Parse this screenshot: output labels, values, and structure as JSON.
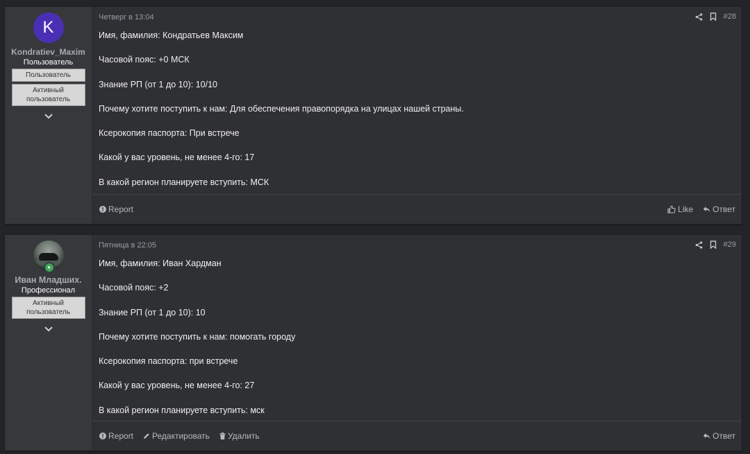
{
  "posts": [
    {
      "user": {
        "avatar_letter": "K",
        "avatar_color": "#4a2fb5",
        "name": "Kondratiev_Maxim",
        "title": "Пользователь",
        "badges": [
          "Пользователь",
          "Активный пользователь"
        ]
      },
      "date": "Четверг в 13:04",
      "number": "#28",
      "lines": [
        "Имя, фамилия: Кондратьев Максим",
        "Часовой пояс: +0 МСК",
        "Знание РП (от 1 до 10): 10/10",
        "Почему хотите поступить к нам: Для обеспечения правопорядка на улицах нашей страны.",
        "Ксерокопия паспорта: При встрече",
        "Какой у вас уровень, не менее 4-го: 17",
        "В какой регион планируете вступить: МСК"
      ],
      "footer": {
        "report": "Report",
        "like": "Like",
        "reply": "Ответ"
      }
    },
    {
      "user": {
        "avatar_icon": "user-photo-avatar",
        "name": "Иван Младших.",
        "title": "Профессионал",
        "badges": [
          "Активный пользователь"
        ]
      },
      "date": "Пятница в 22:05",
      "number": "#29",
      "lines": [
        "Имя, фамилия: Иван Хардман",
        "Часовой пояс: +2",
        "Знание РП (от 1 до 10): 10",
        "Почему хотите поступить к нам: помогать городу",
        "Ксерокопия паспорта: при встрече",
        "Какой у вас уровень, не менее 4-го: 27",
        "В какой регион планируете вступить: мск"
      ],
      "footer": {
        "report": "Report",
        "edit": "Редактировать",
        "delete": "Удалить",
        "reply": "Ответ"
      }
    }
  ]
}
